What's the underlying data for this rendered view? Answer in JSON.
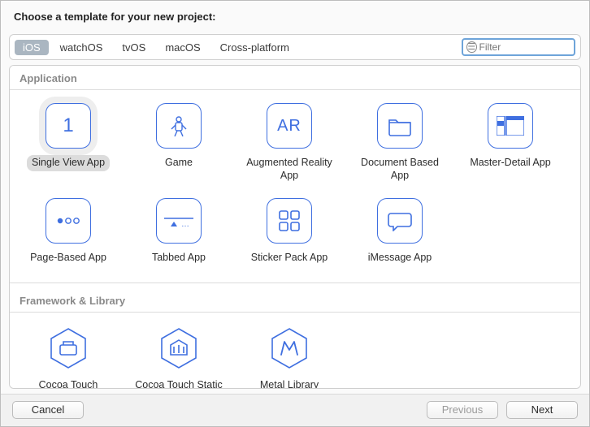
{
  "header": {
    "title": "Choose a template for your new project:"
  },
  "tabs": [
    {
      "label": "iOS",
      "selected": true
    },
    {
      "label": "watchOS",
      "selected": false
    },
    {
      "label": "tvOS",
      "selected": false
    },
    {
      "label": "macOS",
      "selected": false
    },
    {
      "label": "Cross-platform",
      "selected": false
    }
  ],
  "filter": {
    "placeholder": "Filter",
    "value": ""
  },
  "sections": {
    "application": {
      "heading": "Application",
      "items": [
        {
          "label": "Single View App",
          "selected": true,
          "icon": "digit-1-icon"
        },
        {
          "label": "Game",
          "selected": false,
          "icon": "game-icon"
        },
        {
          "label": "Augmented Reality App",
          "selected": false,
          "icon": "ar-icon"
        },
        {
          "label": "Document Based App",
          "selected": false,
          "icon": "document-icon"
        },
        {
          "label": "Master-Detail App",
          "selected": false,
          "icon": "master-detail-icon"
        },
        {
          "label": "Page-Based App",
          "selected": false,
          "icon": "page-based-icon"
        },
        {
          "label": "Tabbed App",
          "selected": false,
          "icon": "tabbed-icon"
        },
        {
          "label": "Sticker Pack App",
          "selected": false,
          "icon": "sticker-icon"
        },
        {
          "label": "iMessage App",
          "selected": false,
          "icon": "imessage-icon"
        }
      ]
    },
    "framework": {
      "heading": "Framework & Library",
      "items": [
        {
          "label": "Cocoa Touch Framework",
          "icon": "framework-icon"
        },
        {
          "label": "Cocoa Touch Static Library",
          "icon": "static-library-icon"
        },
        {
          "label": "Metal Library",
          "icon": "metal-icon"
        }
      ]
    }
  },
  "buttons": {
    "cancel": "Cancel",
    "previous": "Previous",
    "next": "Next"
  },
  "colors": {
    "accent": "#3f6fe0",
    "tab_selected_bg": "#aab6c1",
    "filter_focus_border": "#6ea4d9"
  }
}
